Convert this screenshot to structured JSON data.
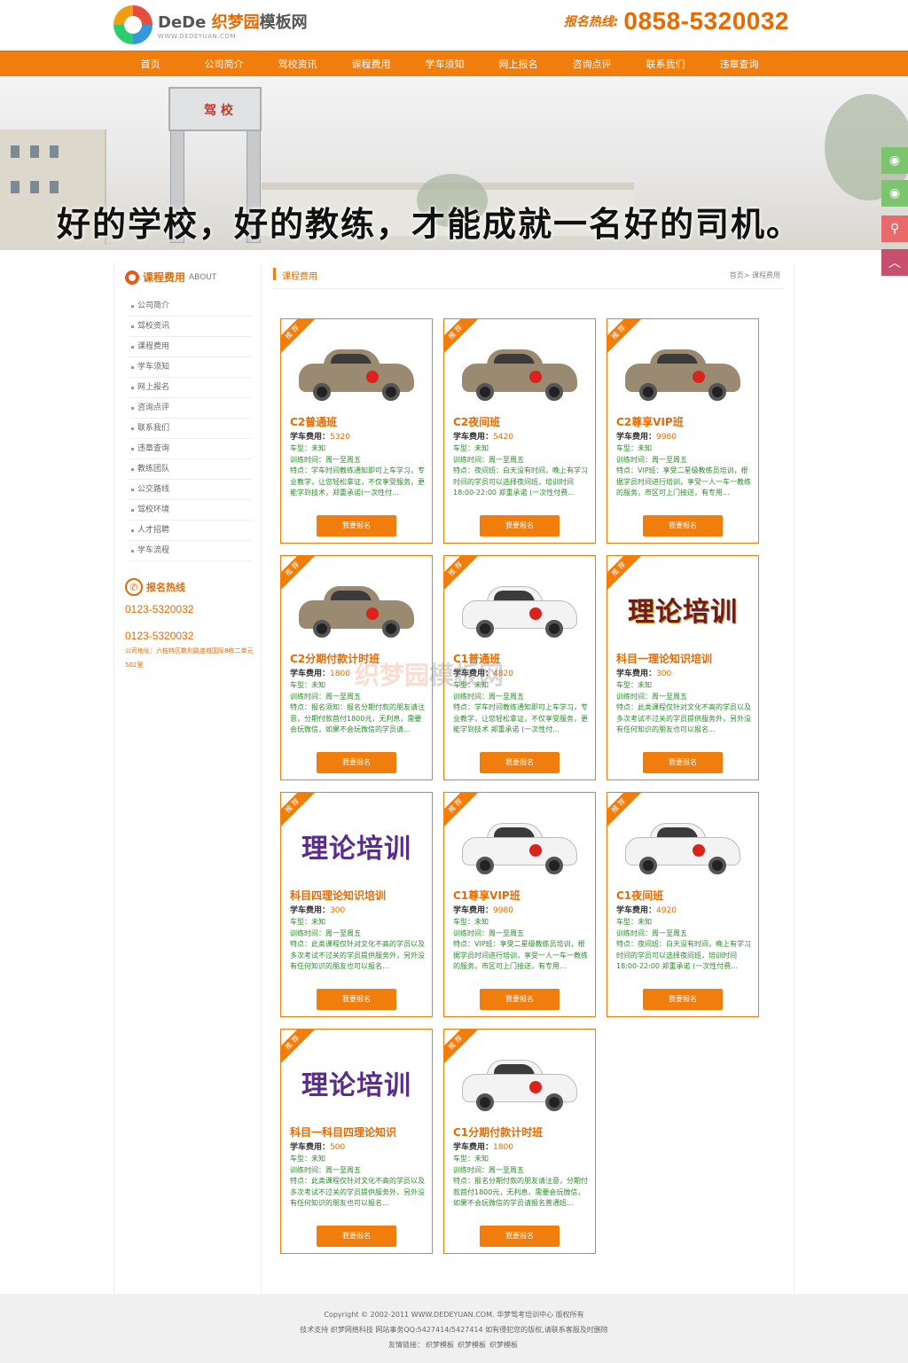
{
  "header": {
    "logo_brand": "DeDe",
    "logo_name_cn": "织梦园",
    "logo_name_suffix": "模板网",
    "logo_url": "WWW.DEDEYUAN.COM",
    "hotline_label": "报名热线:",
    "hotline_number": "0858-5320032"
  },
  "nav": {
    "items": [
      {
        "label": "首页"
      },
      {
        "label": "公司简介"
      },
      {
        "label": "驾校资讯"
      },
      {
        "label": "课程费用"
      },
      {
        "label": "学车须知"
      },
      {
        "label": "网上报名"
      },
      {
        "label": "咨询点评"
      },
      {
        "label": "联系我们"
      },
      {
        "label": "违章查询"
      }
    ]
  },
  "banner": {
    "slogan": "好的学校，好的教练，才能成就一名好的司机。",
    "gate_sign": "驾 校"
  },
  "sidebar": {
    "title": "课程费用",
    "title_en": "ABOUT",
    "items": [
      {
        "label": "公司简介"
      },
      {
        "label": "驾校资讯"
      },
      {
        "label": "课程费用"
      },
      {
        "label": "学车须知"
      },
      {
        "label": "网上报名"
      },
      {
        "label": "咨询点评"
      },
      {
        "label": "联系我们"
      },
      {
        "label": "违章查询"
      },
      {
        "label": "教练团队"
      },
      {
        "label": "公交路线"
      },
      {
        "label": "驾校环境"
      },
      {
        "label": "人才招聘"
      },
      {
        "label": "学车流程"
      }
    ],
    "contact_title": "报名热线",
    "contact_phone": "0123-5320032",
    "contact_phone2": "0123-5320032",
    "contact_addr": "公司地址：六枝特区数利路连城国际8栋二单元502室"
  },
  "content": {
    "title": "课程费用",
    "breadcrumb": "首页> 课程费用",
    "ribbon": "推 荐",
    "fee_label": "学车费用：",
    "button_label": "我要报名",
    "cards": [
      {
        "image": "car-brown",
        "title": "C2普通班",
        "fee": "5320",
        "type": "车型：未知",
        "time": "训练时间：周一至周五",
        "desc": "特点：学车时间教练通知即可上车学习，专业教学，让您轻松拿证，不仅享受服务，更能学到技术，郑重承诺(一次性付..."
      },
      {
        "image": "car-brown",
        "title": "C2夜间班",
        "fee": "5420",
        "type": "车型：未知",
        "time": "训练时间：周一至周五",
        "desc": "特点：夜间班：白天没有时间，晚上有学习时间的学员可以选择夜间班，培训时间 18:00-22:00 郑重承诺 (一次性付费..."
      },
      {
        "image": "car-brown",
        "title": "C2尊享VIP班",
        "fee": "9980",
        "type": "车型：未知",
        "time": "训练时间：周一至周五",
        "desc": "特点：VIP班：享受二星级教练员培训，根据学员时间进行培训，享受一人一车一教练的服务，市区可上门接送，有专用..."
      },
      {
        "image": "car-brown",
        "title": "C2分期付款计时班",
        "fee": "1800",
        "type": "车型：未知",
        "time": "训练时间：周一至周五",
        "desc": "特点：报名须知：报名分期付款的朋友请注意，分期付款首付1800元，无利息，需要会玩微信，如果不会玩微信的学员请..."
      },
      {
        "image": "car-white",
        "title": "C1普通班",
        "fee": "4820",
        "type": "车型：未知",
        "time": "训练时间：周一至周五",
        "desc": "特点：学车时间教练通知即可上车学习，专业教学，让您轻松拿证，不仅享受服务，更能学到技术 郑重承诺 (一次性付..."
      },
      {
        "image": "theory",
        "title": "科目一理论知识培训",
        "fee": "300",
        "type": "车型：未知",
        "time": "训练时间：周一至周五",
        "desc": "特点：此类课程仅针对文化不高的学员以及多次考试不过关的学员提供服务外，另外没有任何知识的朋友也可以报名..."
      },
      {
        "image": "theory",
        "title": "科目四理论知识培训",
        "fee": "300",
        "type": "车型：未知",
        "time": "训练时间：周一至周五",
        "desc": "特点：此类课程仅针对文化不高的学员以及多次考试不过关的学员提供服务外，另外没有任何知识的朋友也可以报名..."
      },
      {
        "image": "car-white",
        "title": "C1尊享VIP班",
        "fee": "9980",
        "type": "车型：未知",
        "time": "训练时间：周一至周五",
        "desc": "特点：VIP班：享受二星级教练员培训，根据学员时间进行培训，享受一人一车一教练的服务，市区可上门接送，有专用..."
      },
      {
        "image": "car-white",
        "title": "C1夜间班",
        "fee": "4920",
        "type": "车型：未知",
        "time": "训练时间：周一至周五",
        "desc": "特点：夜间班：白天没有时间，晚上有学习时间的学员可以选择夜间班，培训时间 18:00-22:00 郑重承诺 (一次性付费..."
      },
      {
        "image": "theory",
        "title": "科目一科目四理论知识",
        "fee": "500",
        "type": "车型：未知",
        "time": "训练时间：周一至周五",
        "desc": "特点：此类课程仅针对文化不高的学员以及多次考试不过关的学员提供服务外，另外没有任何知识的朋友也可以报名..."
      },
      {
        "image": "car-white",
        "title": "C1分期付款计时班",
        "fee": "1800",
        "type": "车型：未知",
        "time": "训练时间：周一至周五",
        "desc": "特点：报名分期付款的朋友请注意，分期付款首付1800元，无利息，需要会玩微信，如果不会玩微信的学员请报名普通班..."
      }
    ],
    "theory_text": "理论培训",
    "watermark_main": "织梦园",
    "watermark_suffix": "模板网"
  },
  "footer": {
    "copyright": "Copyright © 2002-2011 WWW.DEDEYUAN.COM. 华梦驾考培训中心 版权所有",
    "support": "技术支持 织梦网络科技 网站事务QQ:5427414/5427414 如有侵犯您的版权,请联系客服及时删除",
    "links_label": "友情链接：",
    "links": [
      "织梦模板",
      "织梦模板",
      "织梦模板"
    ]
  },
  "colors": {
    "brand_orange": "#f07d0c",
    "desc_green": "#2f8a2f"
  }
}
